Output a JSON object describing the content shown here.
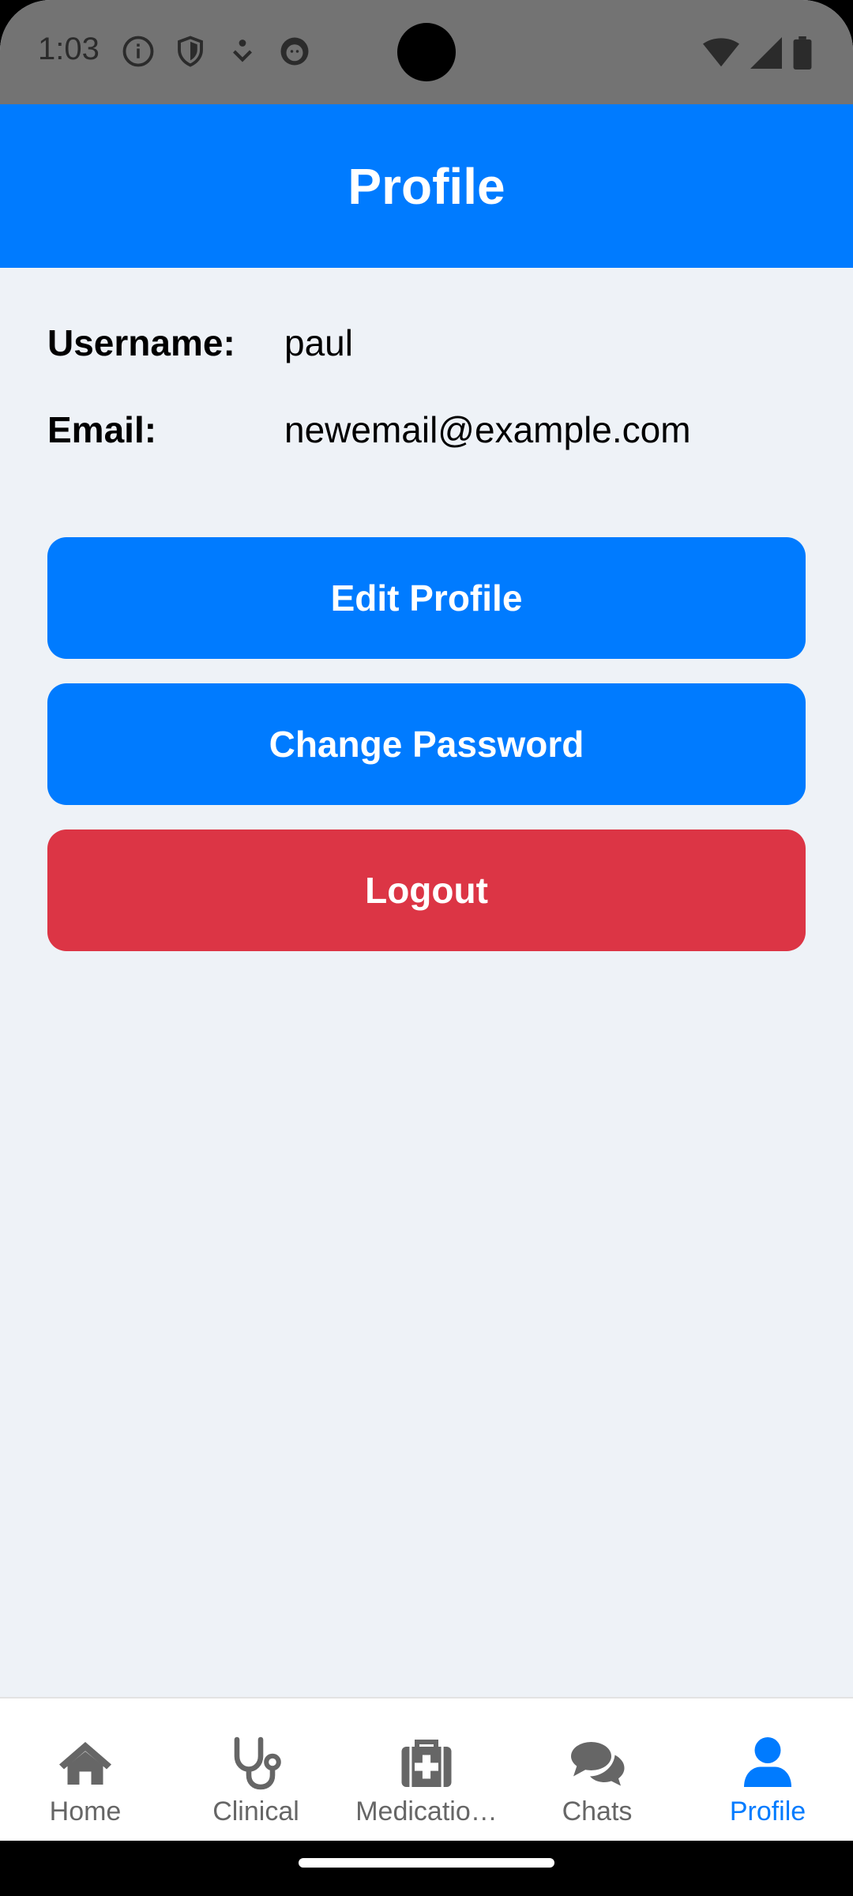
{
  "status_bar": {
    "time": "1:03",
    "left_icons": [
      "info-icon",
      "shield-icon",
      "download-icon",
      "cat-icon"
    ],
    "right_icons": [
      "wifi-icon",
      "signal-icon",
      "battery-icon"
    ]
  },
  "header": {
    "title": "Profile"
  },
  "profile": {
    "username_label": "Username:",
    "username_value": "paul",
    "email_label": "Email:",
    "email_value": "newemail@example.com"
  },
  "actions": {
    "edit_profile": "Edit Profile",
    "change_password": "Change Password",
    "logout": "Logout"
  },
  "bottom_nav": {
    "items": [
      {
        "label": "Home",
        "icon": "home-icon"
      },
      {
        "label": "Clinical",
        "icon": "stethoscope-icon"
      },
      {
        "label": "Medicatio…",
        "icon": "medical-kit-icon"
      },
      {
        "label": "Chats",
        "icon": "chat-bubbles-icon"
      },
      {
        "label": "Profile",
        "icon": "user-icon",
        "active": true
      }
    ]
  },
  "colors": {
    "primary": "#007BFF",
    "danger": "#DC3545",
    "background": "#EEF2F7",
    "nav_inactive": "#666666"
  }
}
